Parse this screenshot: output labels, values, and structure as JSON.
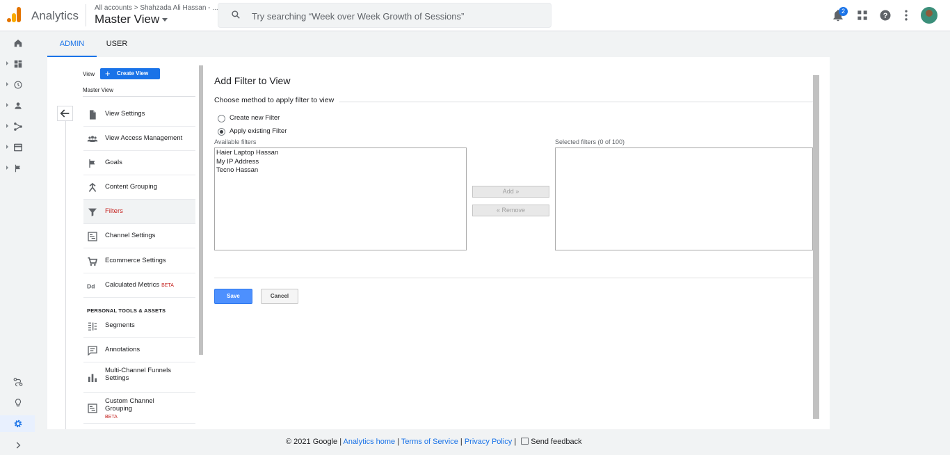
{
  "header": {
    "app_name": "Analytics",
    "breadcrumb": "All accounts > Shahzada Ali Hassan - ...",
    "view_name": "Master View",
    "search_placeholder": "Try searching “Week over Week Growth of Sessions”",
    "notification_count": "2",
    "icons": [
      "notifications-icon",
      "apps-icon",
      "help-icon",
      "more-vert-icon",
      "account-avatar"
    ]
  },
  "rail": {
    "icons": [
      "home-icon",
      "customization-icon",
      "realtime-icon",
      "audience-icon",
      "acquisition-icon",
      "behavior-icon",
      "conversions-icon",
      "attribution-icon",
      "discover-icon",
      "admin-icon",
      "expand-icon"
    ]
  },
  "tabs": {
    "admin": "ADMIN",
    "user": "USER"
  },
  "view_column": {
    "view_label": "View",
    "create_view": "Create View",
    "current_view": "Master View",
    "items": [
      {
        "label": "View Settings",
        "icon": "document-icon"
      },
      {
        "label": "View Access Management",
        "icon": "people-icon"
      },
      {
        "label": "Goals",
        "icon": "flag-icon"
      },
      {
        "label": "Content Grouping",
        "icon": "content-grouping-icon"
      },
      {
        "label": "Filters",
        "icon": "filter-icon"
      },
      {
        "label": "Channel Settings",
        "icon": "channel-settings-icon"
      },
      {
        "label": "Ecommerce Settings",
        "icon": "cart-icon"
      },
      {
        "label": "Calculated Metrics",
        "icon": "calculated-metrics-icon",
        "badge": "BETA"
      }
    ],
    "section_title": "PERSONAL TOOLS & ASSETS",
    "tools": [
      {
        "label": "Segments",
        "icon": "segments-icon"
      },
      {
        "label": "Annotations",
        "icon": "annotations-icon"
      },
      {
        "label": "Multi-Channel Funnels Settings",
        "icon": "bar-chart-icon"
      },
      {
        "label": "Custom Channel Grouping",
        "icon": "channel-grouping-icon",
        "badge": "BETA"
      }
    ]
  },
  "form": {
    "title": "Add Filter to View",
    "method_label": "Choose method to apply filter to view",
    "radio_new": "Create new Filter",
    "radio_existing": "Apply existing Filter",
    "available_label": "Available filters",
    "available": [
      "Haier Laptop Hassan",
      "My IP Address",
      "Tecno Hassan"
    ],
    "selected_label": "Selected filters (0 of 100)",
    "add_button": "Add »",
    "remove_button": "« Remove",
    "save": "Save",
    "cancel": "Cancel"
  },
  "footer": {
    "copyright": "© 2021 Google",
    "analytics_home": "Analytics home",
    "terms": "Terms of Service",
    "privacy": "Privacy Policy",
    "feedback": "Send feedback"
  }
}
